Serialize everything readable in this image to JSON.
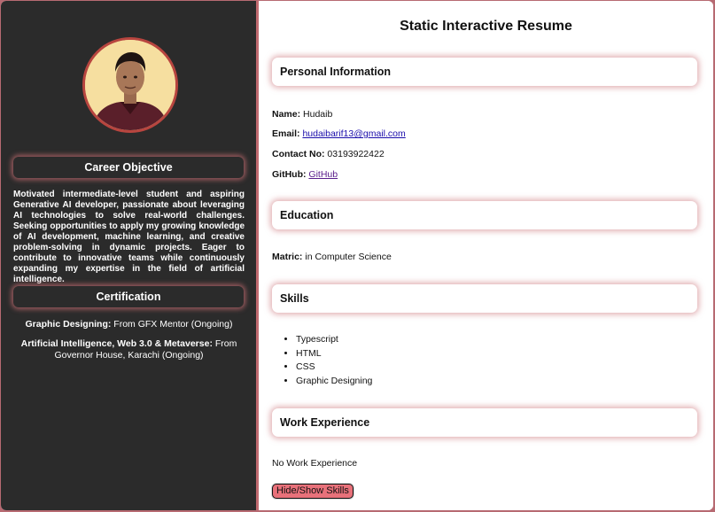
{
  "sidebar": {
    "career_heading": "Career Objective",
    "objective": "Motivated intermediate-level student and aspiring Generative AI developer, passionate about leveraging AI technologies to solve real-world challenges. Seeking opportunities to apply my growing knowledge of AI development, machine learning, and creative problem-solving in dynamic projects. Eager to contribute to innovative teams while continuously expanding my expertise in the field of artificial intelligence.",
    "certification_heading": "Certification",
    "certifications": [
      {
        "title": "Graphic Designing:",
        "detail": "From GFX Mentor (Ongoing)"
      },
      {
        "title": "Artificial Intelligence, Web 3.0 & Metaverse:",
        "detail": "From Governor House, Karachi (Ongoing)"
      }
    ]
  },
  "main": {
    "title": "Static Interactive Resume",
    "personal": {
      "heading": "Personal Information",
      "name_label": "Name:",
      "name": "Hudaib",
      "email_label": "Email:",
      "email": "hudaibarif13@gmail.com",
      "contact_label": "Contact No:",
      "contact": "03193922422",
      "github_label": "GitHub:",
      "github": "GitHub"
    },
    "education": {
      "heading": "Education",
      "matric_label": "Matric:",
      "matric": "in Computer Science"
    },
    "skills": {
      "heading": "Skills",
      "items": [
        "Typescript",
        "HTML",
        "CSS",
        "Graphic Designing"
      ]
    },
    "work": {
      "heading": "Work Experience",
      "text": "No Work Experience"
    },
    "toggle_button": "Hide/Show Skills"
  },
  "colors": {
    "sidebar_bg": "#2b2b2b",
    "accent": "#c06a70",
    "button_bg": "#e8717a",
    "avatar_bg": "#f6dfa0"
  }
}
